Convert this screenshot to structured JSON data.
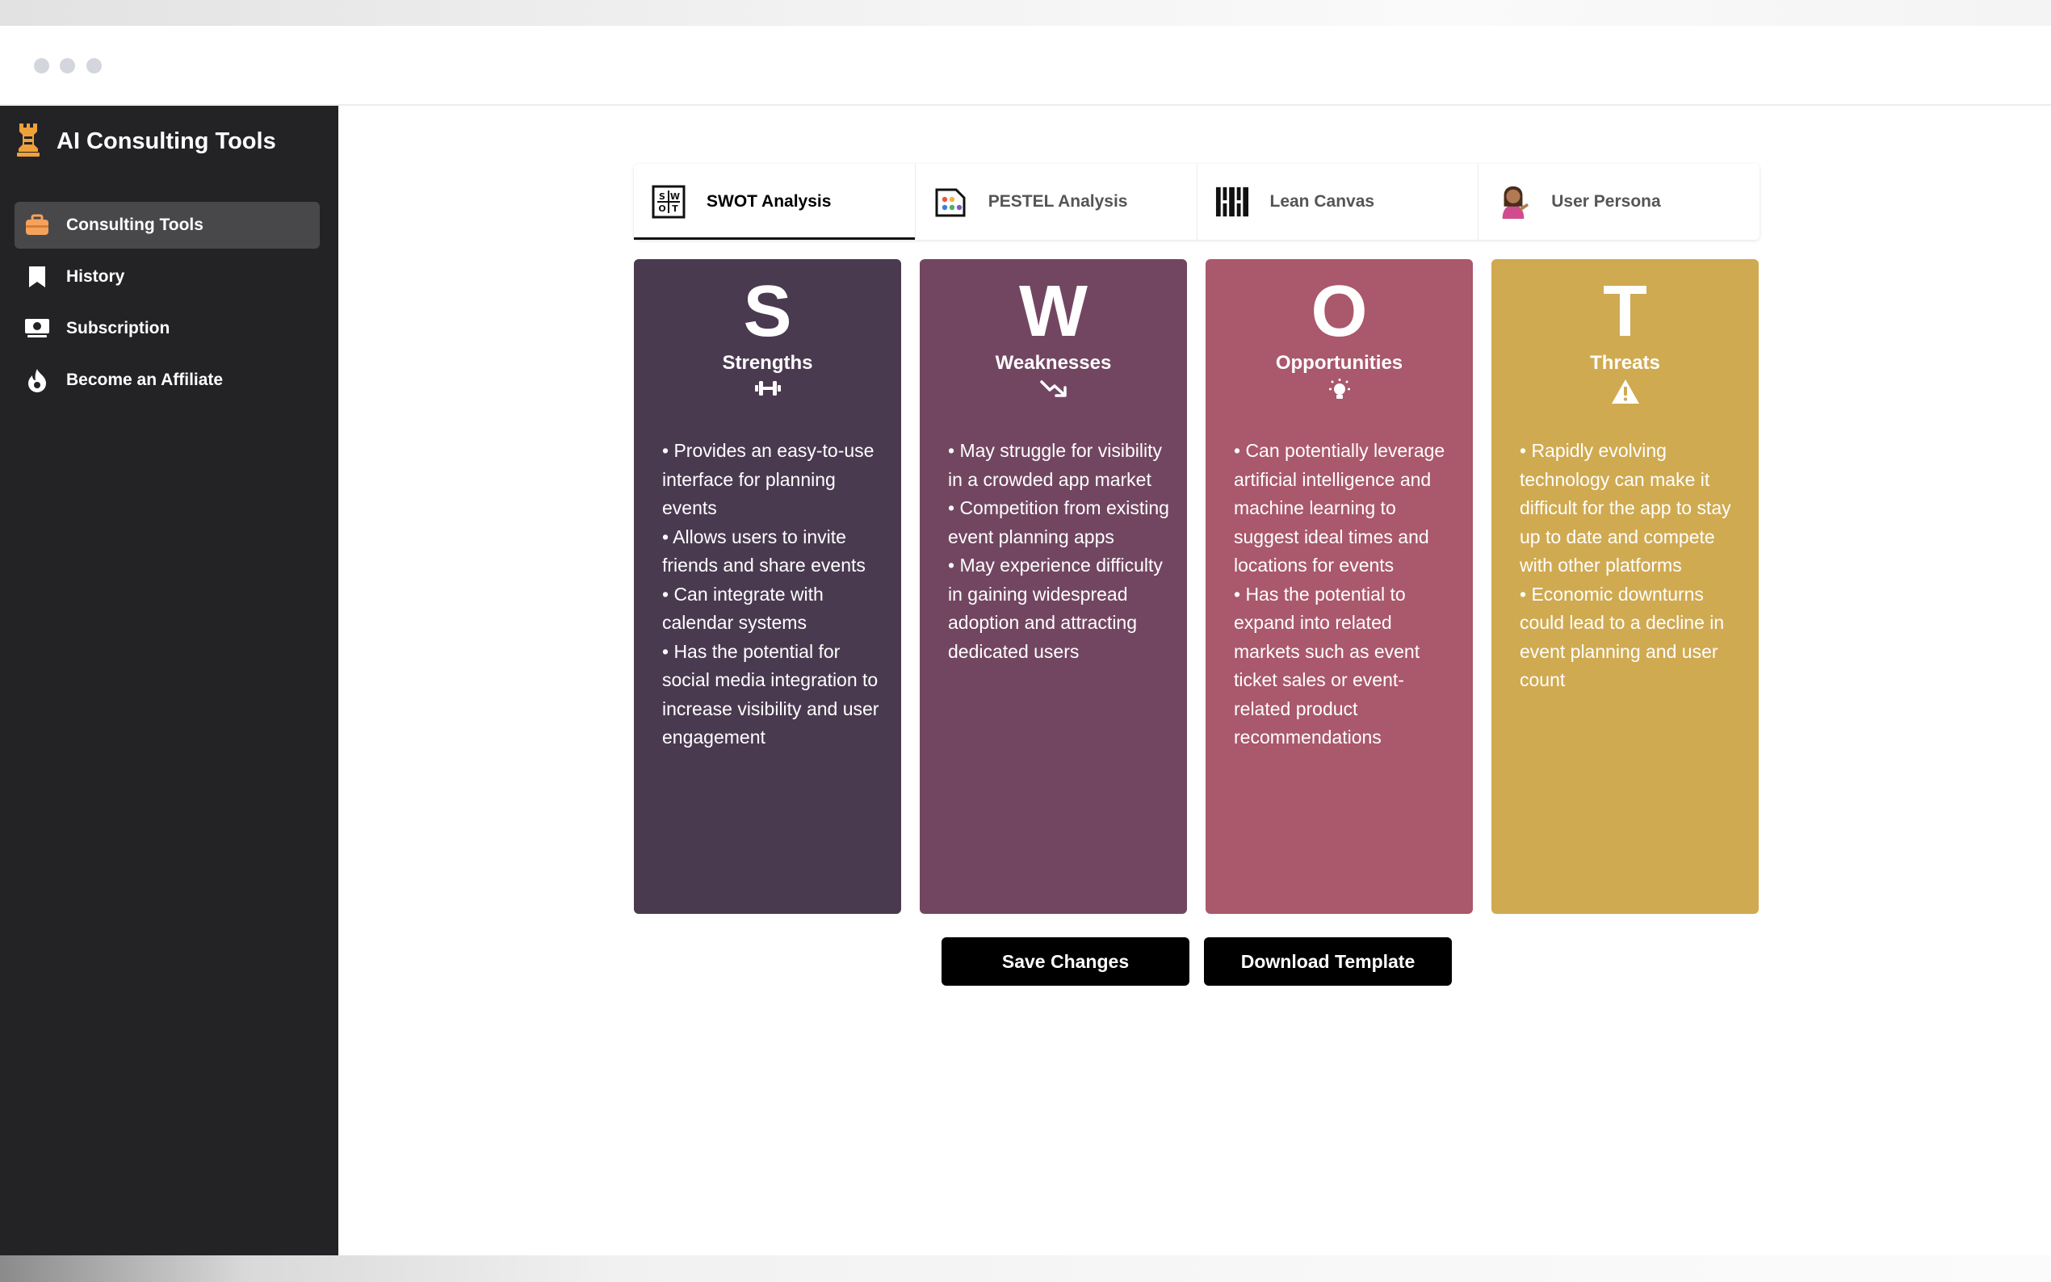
{
  "window": {
    "controls": [
      "close-dot",
      "minimize-dot",
      "maximize-dot"
    ]
  },
  "sidebar": {
    "brand_title": "AI Consulting Tools",
    "brand_icon": "chess-rook-icon",
    "items": [
      {
        "label": "Consulting Tools",
        "icon": "briefcase-icon",
        "active": true
      },
      {
        "label": "History",
        "icon": "bookmark-icon",
        "active": false
      },
      {
        "label": "Subscription",
        "icon": "money-bill-icon",
        "active": false
      },
      {
        "label": "Become an Affiliate",
        "icon": "fire-icon",
        "active": false
      }
    ]
  },
  "tabs": [
    {
      "label": "SWOT Analysis",
      "icon": "swot-grid-icon",
      "active": true
    },
    {
      "label": "PESTEL Analysis",
      "icon": "pestel-dots-icon",
      "active": false
    },
    {
      "label": "Lean Canvas",
      "icon": "lean-canvas-icon",
      "active": false
    },
    {
      "label": "User Persona",
      "icon": "persona-emoji-icon",
      "active": false
    }
  ],
  "swot": [
    {
      "letter": "S",
      "name": "Strengths",
      "icon": "dumbbell-icon",
      "color": "#4a3a50",
      "text": "• Provides an easy-to-use interface for planning events\n• Allows users to invite friends and share events\n• Can integrate with calendar systems\n• Has the potential for social media integration to increase visibility and user engagement"
    },
    {
      "letter": "W",
      "name": "Weaknesses",
      "icon": "trend-down-icon",
      "color": "#724661",
      "text": "• May struggle for visibility in a crowded app market\n• Competition from existing event planning apps\n• May experience difficulty in gaining widespread adoption and attracting dedicated users"
    },
    {
      "letter": "O",
      "name": "Opportunities",
      "icon": "lightbulb-icon",
      "color": "#aa586b",
      "text": "• Can potentially leverage artificial intelligence and machine learning to suggest ideal times and locations for events\n• Has the potential to expand into related markets such as event ticket sales or event-related product recommendations"
    },
    {
      "letter": "T",
      "name": "Threats",
      "icon": "warning-icon",
      "color": "#d0aa51",
      "text": "• Rapidly evolving technology can make it difficult for the app to stay up to date and compete with other platforms\n• Economic downturns could lead to a decline in event planning and user count"
    }
  ],
  "actions": {
    "save_label": "Save Changes",
    "download_label": "Download Template"
  }
}
